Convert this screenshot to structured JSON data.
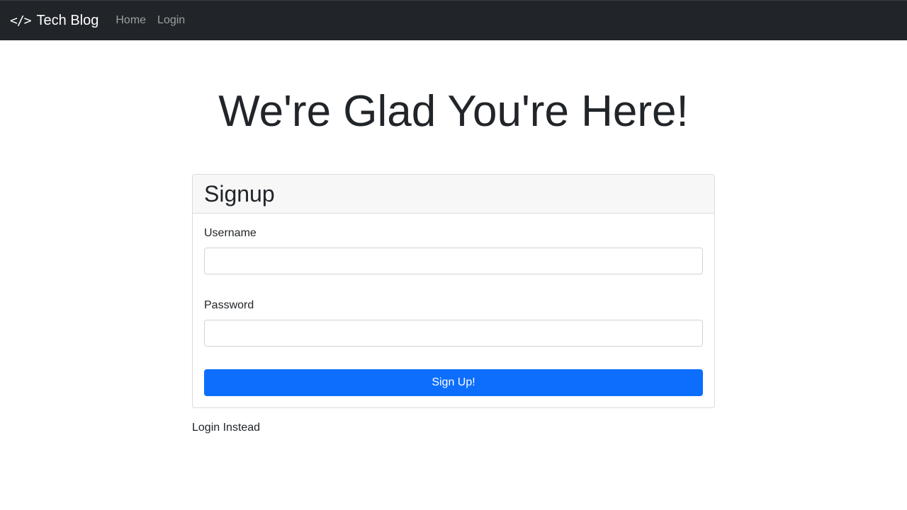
{
  "navbar": {
    "brand_icon": "</>",
    "brand_text": "Tech Blog",
    "links": [
      {
        "label": "Home"
      },
      {
        "label": "Login"
      }
    ]
  },
  "hero": {
    "heading": "We're Glad You're Here!"
  },
  "signup_card": {
    "title": "Signup",
    "username": {
      "label": "Username",
      "value": "",
      "placeholder": ""
    },
    "password": {
      "label": "Password",
      "value": "",
      "placeholder": ""
    },
    "submit_label": "Sign Up!"
  },
  "alt_link": {
    "label": "Login Instead"
  },
  "colors": {
    "navbar_bg": "#212529",
    "primary_button": "#0d6efd",
    "card_header_bg": "#f7f7f7"
  }
}
